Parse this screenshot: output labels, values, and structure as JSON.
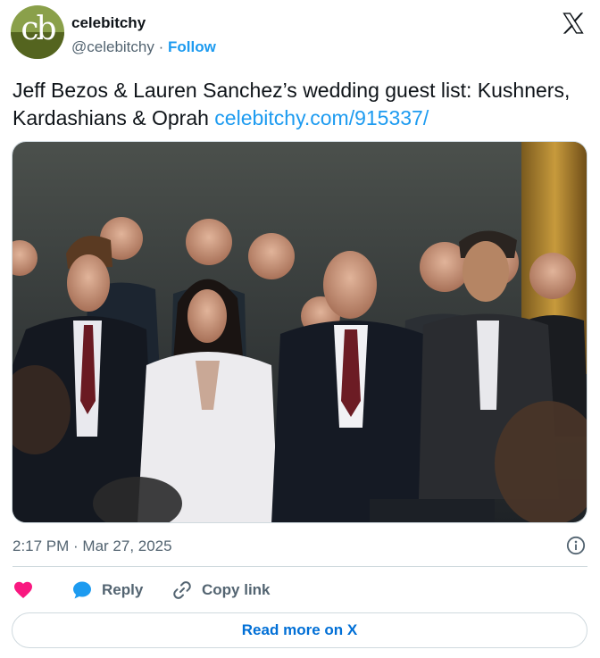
{
  "author": {
    "name": "celebitchy",
    "handle": "@celebitchy",
    "separator": "·",
    "follow_label": "Follow",
    "avatar_text": "cb"
  },
  "tweet": {
    "text_main": "Jeff Bezos & Lauren Sanchez’s wedding guest list: Kushners, Kardashians & Oprah",
    "link_text": "celebitchy.com/915337/",
    "timestamp": "2:17 PM · Mar 27, 2025"
  },
  "actions": {
    "like_icon": "heart-icon",
    "reply_label": "Reply",
    "copy_link_label": "Copy link"
  },
  "read_more_label": "Read more on X",
  "colors": {
    "accent": "#1d9bf0",
    "like": "#f91880",
    "read_more": "#006fd6",
    "avatar_light": "#8aa04a",
    "avatar_dark": "#54641f"
  }
}
